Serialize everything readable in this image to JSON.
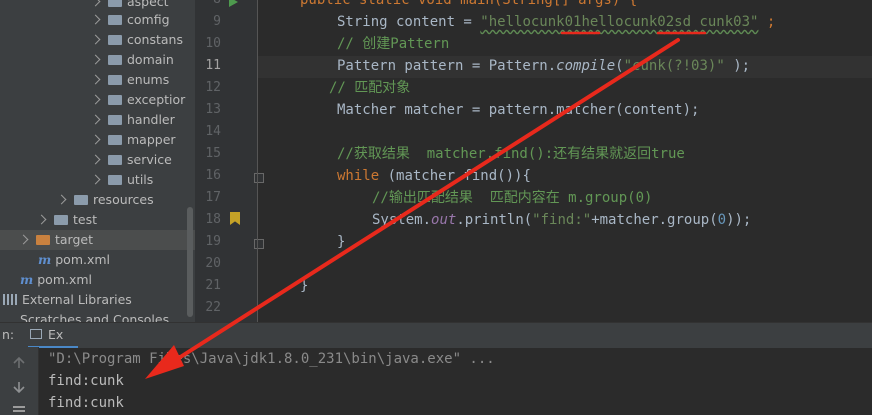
{
  "project_tree": {
    "items": [
      {
        "label": "aspect",
        "kind": "folder"
      },
      {
        "label": "comfig",
        "kind": "folder"
      },
      {
        "label": "constans",
        "kind": "folder"
      },
      {
        "label": "domain",
        "kind": "folder"
      },
      {
        "label": "enums",
        "kind": "folder"
      },
      {
        "label": "exceptior",
        "kind": "folder"
      },
      {
        "label": "handler",
        "kind": "folder"
      },
      {
        "label": "mapper",
        "kind": "folder"
      },
      {
        "label": "service",
        "kind": "folder"
      },
      {
        "label": "utils",
        "kind": "folder"
      },
      {
        "label": "resources",
        "kind": "folder"
      },
      {
        "label": "test",
        "kind": "folder"
      },
      {
        "label": "target",
        "kind": "folder-excluded"
      },
      {
        "label": "pom.xml",
        "kind": "maven"
      },
      {
        "label": "pom.xml",
        "kind": "maven"
      },
      {
        "label": "External Libraries",
        "kind": "libraries"
      },
      {
        "label": "Scratches and Consoles",
        "kind": "scratches"
      }
    ]
  },
  "editor": {
    "line_numbers": [
      "8",
      "9",
      "10",
      "11",
      "12",
      "13",
      "14",
      "15",
      "16",
      "17",
      "18",
      "19",
      "20",
      "21",
      "22"
    ],
    "line8": "public static void main(String[] args) {",
    "line9_prefix": "String content = ",
    "line9_string": "\"hellocunk01hellocunk02sd cunk03\"",
    "line9_suffix": " ;",
    "line10": "// 创建Pattern",
    "line11_a": "Pattern pattern = Pattern.",
    "line11_method": "compile",
    "line11_b": "(",
    "line11_string": "\"cunk(?!03)\"",
    "line11_c": " );",
    "line12": "// 匹配对象",
    "line13": "Matcher matcher = pattern.matcher(content);",
    "line15": "//获取结果  matcher.find():还有结果就返回true",
    "line16_kw": "while",
    "line16_rest": " (matcher.find()){",
    "line17": "//输出匹配结果  匹配内容在 m.group(0)",
    "line18_a": "System.",
    "line18_field": "out",
    "line18_b": ".println(",
    "line18_string": "\"find:\"",
    "line18_c": "+matcher.group(",
    "line18_num": "0",
    "line18_d": "));",
    "line19": "}",
    "line21": "}"
  },
  "run_panel": {
    "header_prefix": "n:",
    "tab_label": "Ex",
    "command": "\"D:\\Program Files\\Java\\jdk1.8.0_231\\bin\\java.exe\" ...",
    "output_lines": [
      "find:cunk",
      "find:cunk"
    ]
  },
  "colors": {
    "annotation": "#e8291c",
    "keyword": "#cc7832",
    "string": "#6a8759",
    "comment": "#629755"
  }
}
